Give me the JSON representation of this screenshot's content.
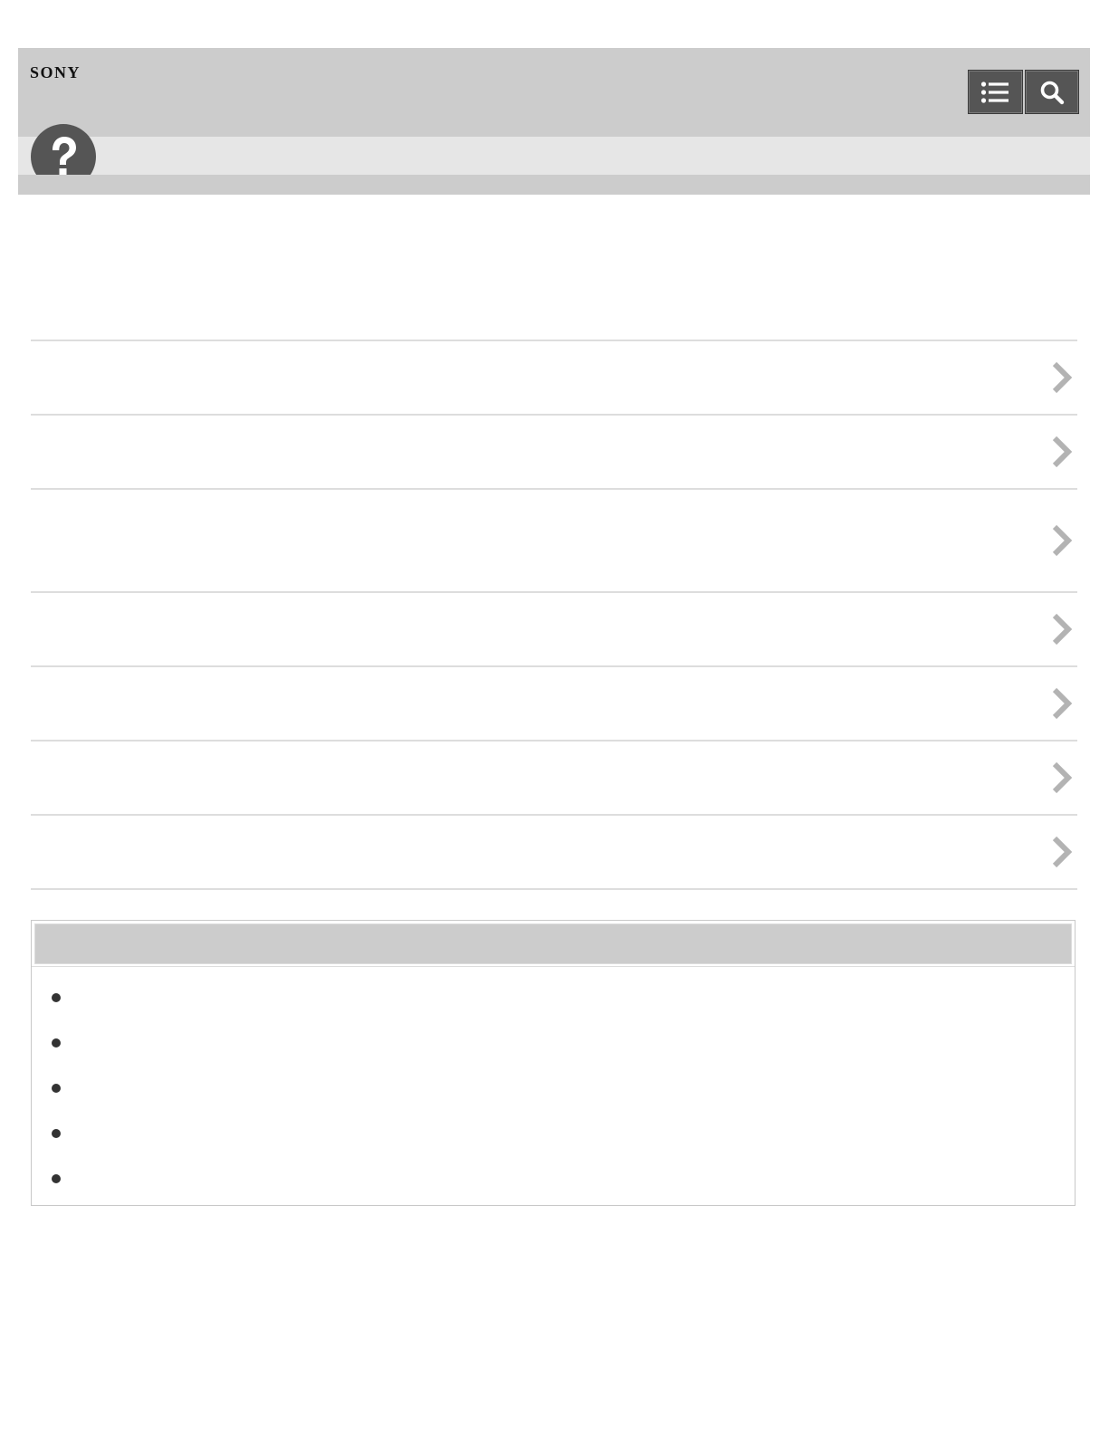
{
  "header": {
    "brand": "SONY",
    "background": "#cccccc",
    "buttons": [
      {
        "name": "contents-list",
        "icon": "list-icon"
      },
      {
        "name": "search",
        "icon": "search-icon"
      }
    ]
  },
  "subbar": {
    "icon": "question-mark-icon",
    "background": "#e6e6e6"
  },
  "list_items": [
    {
      "label": "",
      "icon": "chevron-right-icon"
    },
    {
      "label": "",
      "icon": "chevron-right-icon"
    },
    {
      "label": "",
      "icon": "chevron-right-icon"
    },
    {
      "label": "",
      "icon": "chevron-right-icon"
    },
    {
      "label": "",
      "icon": "chevron-right-icon"
    },
    {
      "label": "",
      "icon": "chevron-right-icon"
    },
    {
      "label": "",
      "icon": "chevron-right-icon"
    }
  ],
  "related": {
    "title": "",
    "items": [
      "",
      "",
      "",
      "",
      ""
    ]
  },
  "colors": {
    "header": "#cccccc",
    "subbar": "#e6e6e6",
    "button": "#555555",
    "chevron": "#b3b3b3",
    "divider": "#dddddd"
  }
}
